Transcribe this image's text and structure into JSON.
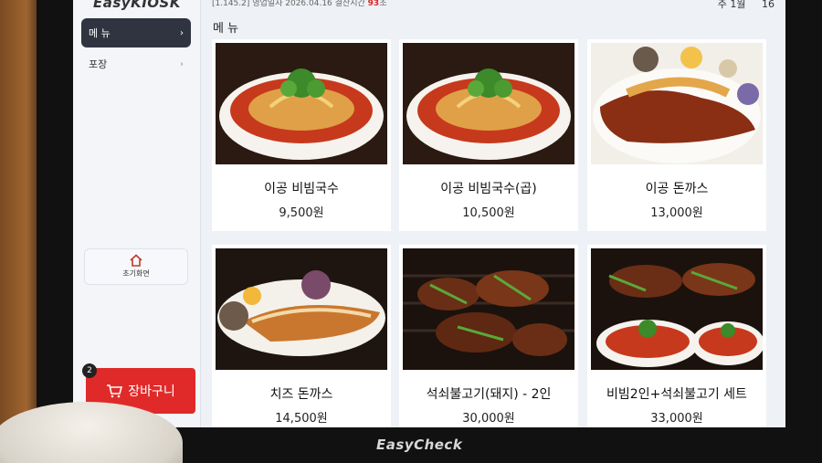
{
  "kiosk": {
    "logo": "EasyKIOSK",
    "footer_brand": "EasyCheck"
  },
  "topbar": {
    "version": "[1.145.2]",
    "business_date_label": "영업일자",
    "business_date": "2026.04.16",
    "open_time_label": "결산시간",
    "open_time_value": "93",
    "open_time_suffix": "초",
    "right_text": "주 1월",
    "right_num": "16"
  },
  "sidebar": {
    "items": [
      {
        "label": "메 뉴",
        "active": true
      },
      {
        "label": "포장",
        "active": false
      }
    ],
    "home_label": "초기화면",
    "cart_label": "장바구니",
    "cart_count": "2"
  },
  "main": {
    "section_title": "메 뉴",
    "menu": [
      {
        "name": "이공 비빔국수",
        "price": "9,500원"
      },
      {
        "name": "이공 비빔국수(곱)",
        "price": "10,500원"
      },
      {
        "name": "이공 돈까스",
        "price": "13,000원"
      },
      {
        "name": "치즈 돈까스",
        "price": "14,500원"
      },
      {
        "name": "석쇠불고기(돼지) - 2인",
        "price": "30,000원"
      },
      {
        "name": "비빔2인+석쇠불고기 세트",
        "price": "33,000원"
      }
    ]
  },
  "colors": {
    "accent_red": "#e02a2a",
    "nav_active": "#2f3440"
  },
  "icons": [
    "chevron-right-icon",
    "home-icon",
    "cart-icon"
  ]
}
